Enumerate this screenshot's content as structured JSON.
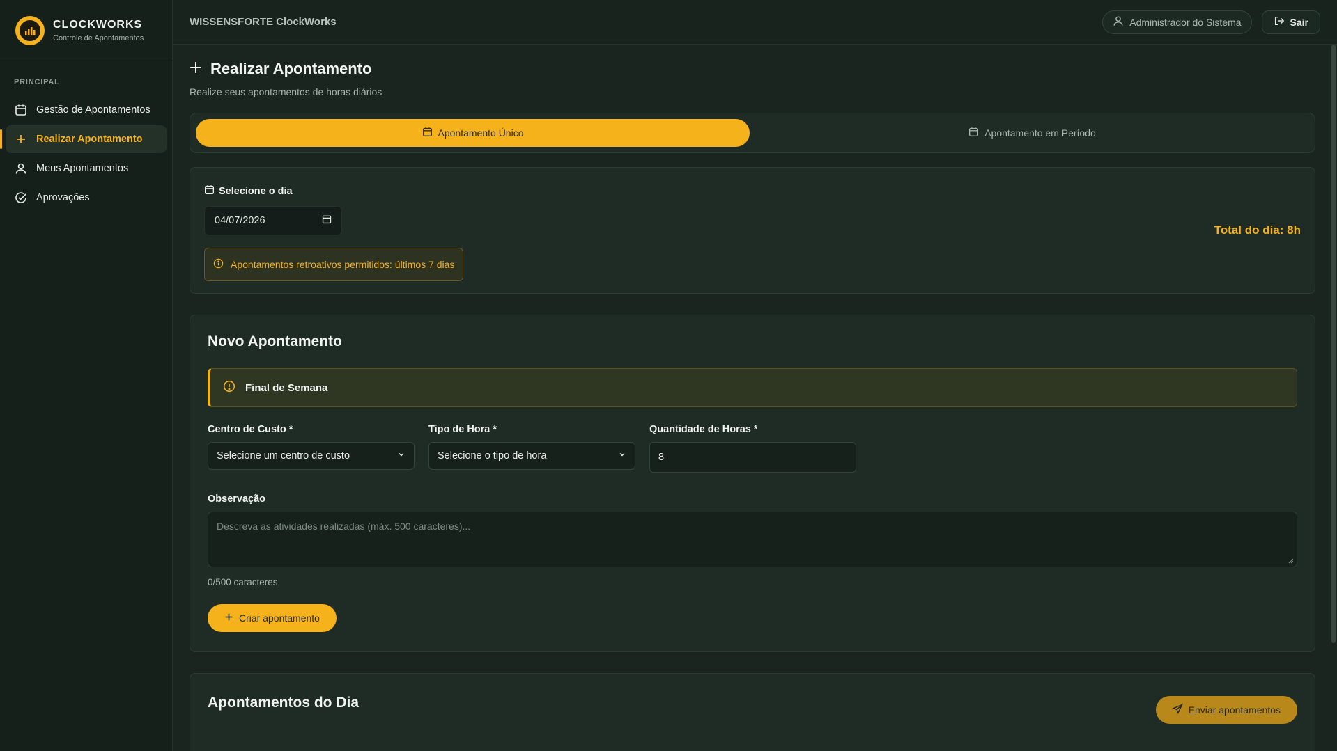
{
  "brand": {
    "title": "CLOCKWORKS",
    "subtitle": "Controle de Apontamentos"
  },
  "sidebar": {
    "section_label": "PRINCIPAL",
    "items": [
      {
        "label": "Gestão de Apontamentos",
        "icon": "calendar-icon",
        "active": false
      },
      {
        "label": "Realizar Apontamento",
        "icon": "plus-icon",
        "active": true
      },
      {
        "label": "Meus Apontamentos",
        "icon": "user-icon",
        "active": false
      },
      {
        "label": "Aprovações",
        "icon": "check-circle-icon",
        "active": false
      }
    ]
  },
  "topbar": {
    "title": "WISSENSFORTE ClockWorks",
    "user_label": "Administrador do Sistema",
    "exit_label": "Sair"
  },
  "page": {
    "title": "Realizar Apontamento",
    "subtitle": "Realize seus apontamentos de horas diários"
  },
  "tabs": [
    {
      "label": "Apontamento Único",
      "active": true
    },
    {
      "label": "Apontamento em Período",
      "active": false
    }
  ],
  "day_select": {
    "label": "Selecione o dia",
    "date_value": "04/07/2026",
    "notice": "Apontamentos retroativos permitidos: últimos 7 dias",
    "total": "Total do dia: 8h"
  },
  "new_entry": {
    "title": "Novo Apontamento",
    "weekend_alert": "Final de Semana",
    "cost_center_label": "Centro de Custo *",
    "cost_center_value": "Selecione um centro de custo",
    "hour_type_label": "Tipo de Hora *",
    "hour_type_value": "Selecione o tipo de hora",
    "quantity_label": "Quantidade de Horas *",
    "quantity_value": "8",
    "observation_label": "Observação",
    "observation_placeholder": "Descreva as atividades realizadas (máx. 500 caracteres)...",
    "counter": "0/500 caracteres",
    "create_button": "Criar apontamento"
  },
  "day_list": {
    "title": "Apontamentos do Dia",
    "send_button": "Enviar apontamentos"
  },
  "colors": {
    "accent": "#f5b21a",
    "background": "#1a2520",
    "sidebar": "#16201b",
    "card": "#1f2b25"
  }
}
